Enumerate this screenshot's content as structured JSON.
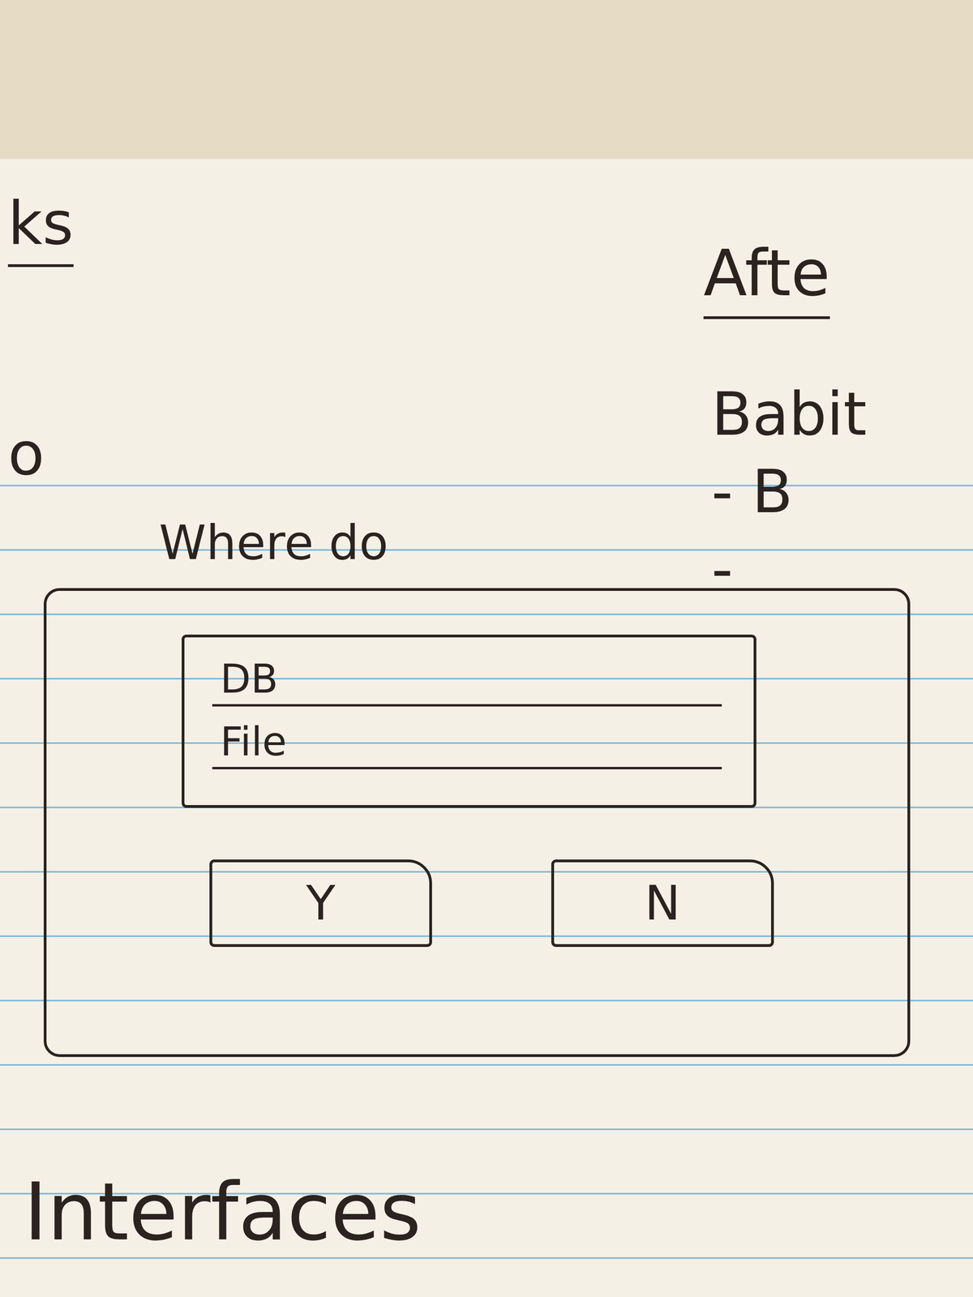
{
  "left_heading": {
    "text": "ks",
    "underlined": true
  },
  "right_heading": {
    "text": "Afte",
    "underlined": true
  },
  "right_notes": [
    "Babit",
    "- B",
    "-"
  ],
  "left_mark": "o",
  "sketch": {
    "title": "Where do",
    "fields": [
      {
        "label": "DB"
      },
      {
        "label": "File"
      }
    ],
    "buttons": [
      "Y",
      "N"
    ]
  },
  "bottom_heading": "Interfaces"
}
